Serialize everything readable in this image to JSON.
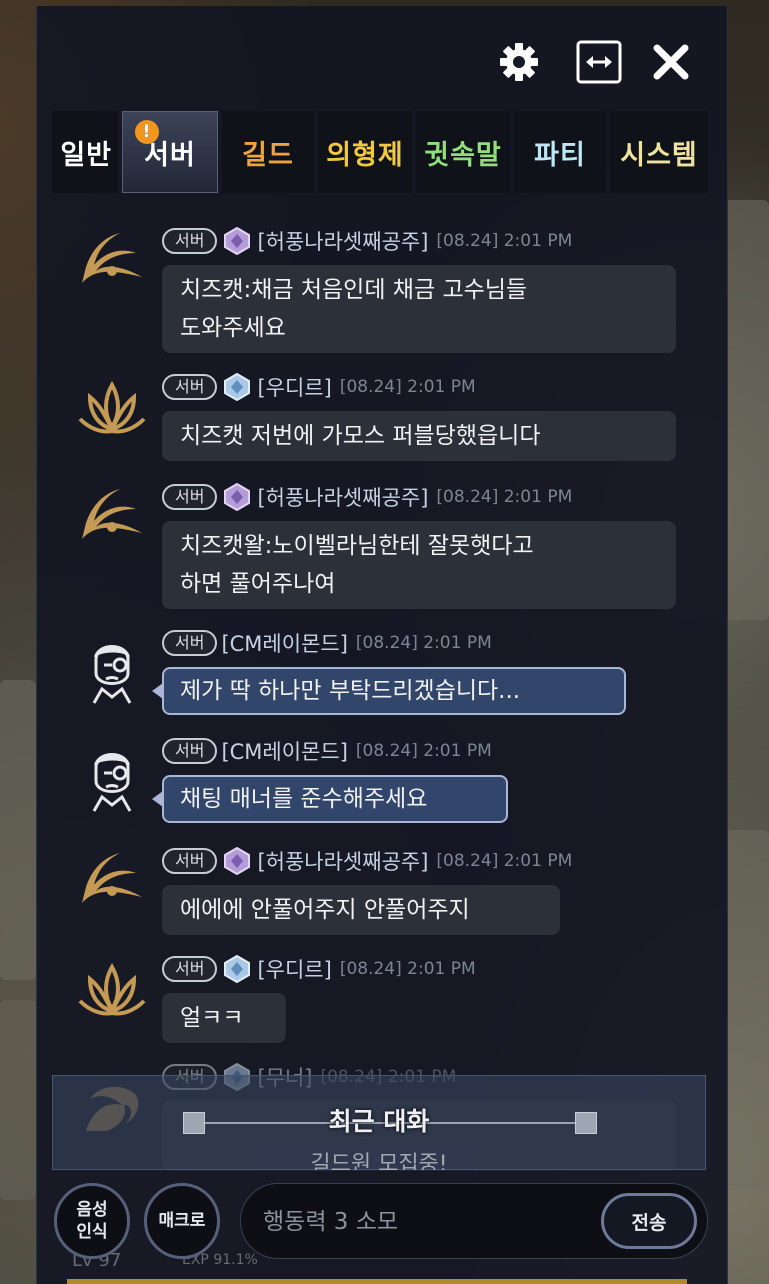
{
  "window": {
    "buttons": {
      "settings_icon": "gear-icon",
      "resize_icon": "resize-horizontal-icon",
      "close_icon": "close-icon"
    }
  },
  "tabs": [
    {
      "label": "일반",
      "color": "#ffffff"
    },
    {
      "label": "서버",
      "color": "#ffffff",
      "active": true,
      "alert": "!"
    },
    {
      "label": "길드",
      "color": "#f2a33a"
    },
    {
      "label": "의형제",
      "color": "#f0c93c"
    },
    {
      "label": "귓속말",
      "color": "#8fe07a"
    },
    {
      "label": "파티",
      "color": "#a8e0f0"
    },
    {
      "label": "시스템",
      "color": "#f0e3a0"
    }
  ],
  "chat": {
    "messages": [
      {
        "badge": "서버",
        "name": "[허풍나라셋째공주]",
        "time": "[08.24] 2:01 PM",
        "lines": [
          "치즈캣:채금 처음인데 채금 고수님들",
          "도와주세요"
        ],
        "avatar": "wing-emblem-icon",
        "gem": "purple-gem-icon"
      },
      {
        "badge": "서버",
        "name": "[우디르]",
        "time": "[08.24] 2:01 PM",
        "lines": [
          "치즈캣 저번에 가모스 퍼블당했읍니다"
        ],
        "avatar": "lotus-emblem-icon",
        "gem": "blue-gem-icon"
      },
      {
        "badge": "서버",
        "name": "[허풍나라셋째공주]",
        "time": "[08.24] 2:01 PM",
        "lines": [
          "치즈캣왈:노이벨라님한테 잘못햇다고",
          "하면 풀어주나여"
        ],
        "avatar": "wing-emblem-icon",
        "gem": "purple-gem-icon"
      },
      {
        "badge": "서버",
        "name": "[CM레이몬드]",
        "time": "[08.24] 2:01 PM",
        "lines": [
          "제가 딱 하나만 부탁드리겠습니다..."
        ],
        "avatar": "cm-avatar-icon",
        "cm": true
      },
      {
        "badge": "서버",
        "name": "[CM레이몬드]",
        "time": "[08.24] 2:01 PM",
        "lines": [
          "채팅 매너를 준수해주세요"
        ],
        "avatar": "cm-avatar-icon",
        "cm": true
      },
      {
        "badge": "서버",
        "name": "[허풍나라셋째공주]",
        "time": "[08.24] 2:01 PM",
        "lines": [
          "에에에 안풀어주지 안풀어주지"
        ],
        "avatar": "wing-emblem-icon",
        "gem": "purple-gem-icon"
      },
      {
        "badge": "서버",
        "name": "[우디르]",
        "time": "[08.24] 2:01 PM",
        "lines": [
          "얼ㅋㅋ"
        ],
        "avatar": "lotus-emblem-icon",
        "gem": "blue-gem-icon"
      },
      {
        "badge": "서버",
        "name": "[무너]",
        "time": "[08.24] 2:01 PM",
        "lines": [],
        "avatar": "dragon-emblem-icon",
        "gem": "blue-gem-icon"
      }
    ]
  },
  "recent": {
    "title": "최근 대화",
    "preview": "길드원 모집중!"
  },
  "bottom": {
    "voice_label": "음성\n인식",
    "macro_label": "매크로",
    "input_placeholder": "행동력 3 소모",
    "send_label": "전송",
    "level": "Lv 97",
    "exp": "EXP 91.1%"
  }
}
